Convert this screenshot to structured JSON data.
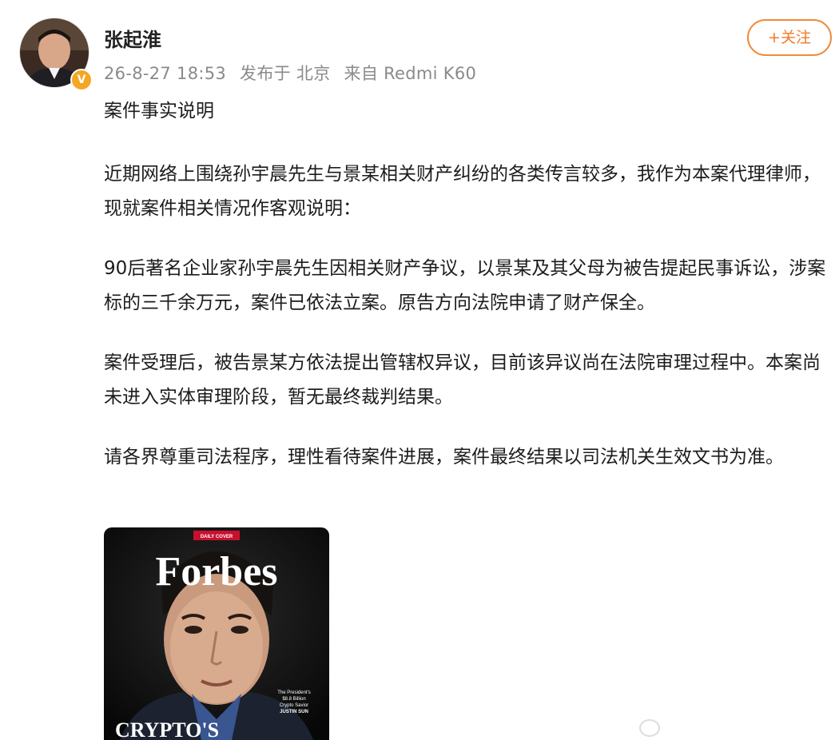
{
  "post": {
    "author": {
      "name": "张起淮",
      "avatar_icon": "person-avatar",
      "verified_badge": "V",
      "verified_color": "#f5a623"
    },
    "meta": {
      "date": "26-8-27 18:53",
      "location": "发布于 北京",
      "source": "来自 Redmi K60"
    },
    "follow_button": "+关注",
    "accent_color": "#f07a28",
    "paragraphs": {
      "p0": "案件事实说明",
      "p1": "近期网络上围绕孙宇晨先生与景某相关财产纠纷的各类传言较多，我作为本案代理律师，现就案件相关情况作客观说明：",
      "p2": "90后著名企业家孙宇晨先生因相关财产争议，以景某及其父母为被告提起民事诉讼，涉案标的三千余万元，案件已依法立案。原告方向法院申请了财产保全。",
      "p3": "案件受理后，被告景某方依法提出管辖权异议，目前该异议尚在法院审理过程中。本案尚未进入实体审理阶段，暂无最终裁判结果。",
      "p4": "请各界尊重司法程序，理性看待案件进展，案件最终结果以司法机关生效文书为准。"
    },
    "image": {
      "badge": "DAILY COVER",
      "masthead": "Forbes",
      "caption_lines": [
        "The President's",
        "$8.8 Billion",
        "Crypto Savior",
        "JUSTIN SUN"
      ],
      "bottom_text": "CRYPTO'S"
    }
  }
}
